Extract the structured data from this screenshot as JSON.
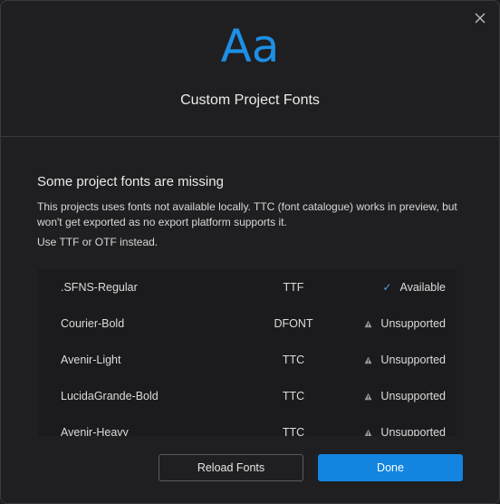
{
  "header": {
    "icon_text": "Aa",
    "title": "Custom Project Fonts"
  },
  "section": {
    "title": "Some project fonts are missing",
    "description": "This projects uses fonts not available locally. TTC (font catalogue) works in preview, but won't get exported as no export platform supports it.",
    "hint": "Use TTF or OTF instead."
  },
  "fonts": [
    {
      "name": ".SFNS-Regular",
      "type": "TTF",
      "status": "Available",
      "status_icon": "check-icon"
    },
    {
      "name": "Courier-Bold",
      "type": "DFONT",
      "status": "Unsupported",
      "status_icon": "warning-icon"
    },
    {
      "name": "Avenir-Light",
      "type": "TTC",
      "status": "Unsupported",
      "status_icon": "warning-icon"
    },
    {
      "name": "LucidaGrande-Bold",
      "type": "TTC",
      "status": "Unsupported",
      "status_icon": "warning-icon"
    },
    {
      "name": "Avenir-Heavy",
      "type": "TTC",
      "status": "Unsupported",
      "status_icon": "warning-icon"
    }
  ],
  "buttons": {
    "reload": "Reload Fonts",
    "done": "Done"
  },
  "colors": {
    "accent": "#1384e0",
    "brand_icon": "#1d8fe6",
    "background": "#1f1f21"
  }
}
